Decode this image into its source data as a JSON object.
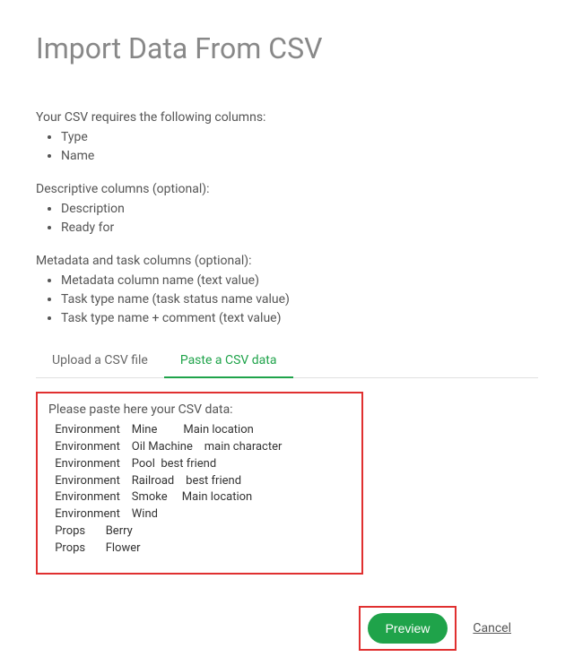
{
  "title": "Import Data From CSV",
  "requiredIntro": "Your CSV requires the following columns:",
  "requiredColumns": [
    "Type",
    "Name"
  ],
  "descriptiveIntro": "Descriptive columns (optional):",
  "descriptiveColumns": [
    "Description",
    "Ready for"
  ],
  "metadataIntro": "Metadata and task columns (optional):",
  "metadataColumns": [
    "Metadata column name (text value)",
    "Task type name (task status name value)",
    "Task type name + comment (text value)"
  ],
  "tabs": {
    "upload": "Upload a CSV file",
    "paste": "Paste a CSV data"
  },
  "pasteLabel": "Please paste here your CSV data:",
  "csvData": " Environment    Mine         Main location\n Environment    Oil Machine    main character\n Environment    Pool  best friend\n Environment    Railroad    best friend\n Environment    Smoke     Main location\n Environment    Wind\n Props       Berry\n Props       Flower",
  "actions": {
    "preview": "Preview",
    "cancel": "Cancel"
  }
}
